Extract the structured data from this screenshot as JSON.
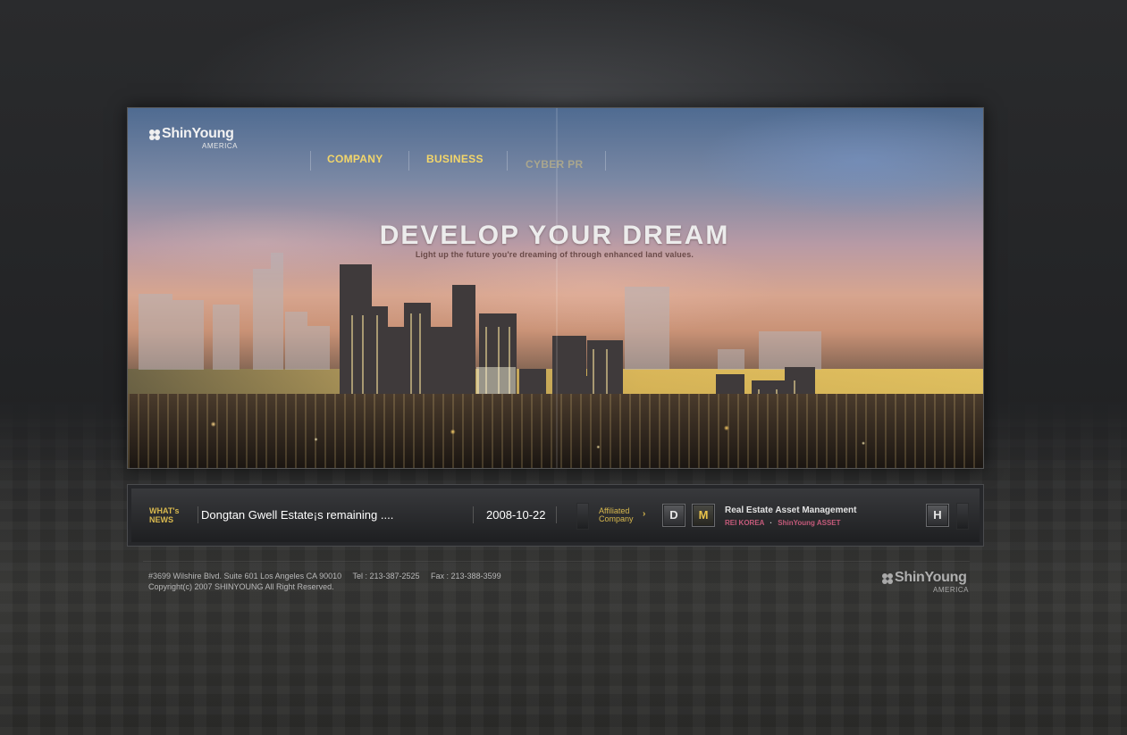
{
  "brand": {
    "name": "ShinYoung",
    "sub": "AMERICA"
  },
  "nav": {
    "items": [
      "COMPANY",
      "BUSINESS",
      "CYBER PR"
    ]
  },
  "hero": {
    "title": "DEVELOP YOUR DREAM",
    "subtitle": "Light up the future you're dreaming of through enhanced land values."
  },
  "news": {
    "label_line1": "WHAT's",
    "label_line2": "NEWS",
    "headline": "Dongtan Gwell Estate¡s remaining ....",
    "date": "2008-10-22"
  },
  "affiliated": {
    "line1": "Affiliated",
    "line2": "Company",
    "arrow": "›",
    "buttons": [
      "D",
      "M"
    ],
    "title": "Real Estate Asset Management",
    "link1": "REI KOREA",
    "dot": "·",
    "link2": "ShinYoung ASSET",
    "home_button": "H"
  },
  "footer": {
    "address": "#3699 Wilshire Blvd. Suite 601 Los Angeles CA 90010     Tel : 213-387-2525     Fax : 213-388-3599",
    "copyright": "Copyright(c) 2007 SHINYOUNG All Right Reserved."
  },
  "colors": {
    "background": "#252628",
    "accent_gold": "#f3d66a",
    "link_pink": "#c45a7a"
  },
  "icons": [
    "shinyoung-logo-mark-icon",
    "chevron-right-icon"
  ]
}
